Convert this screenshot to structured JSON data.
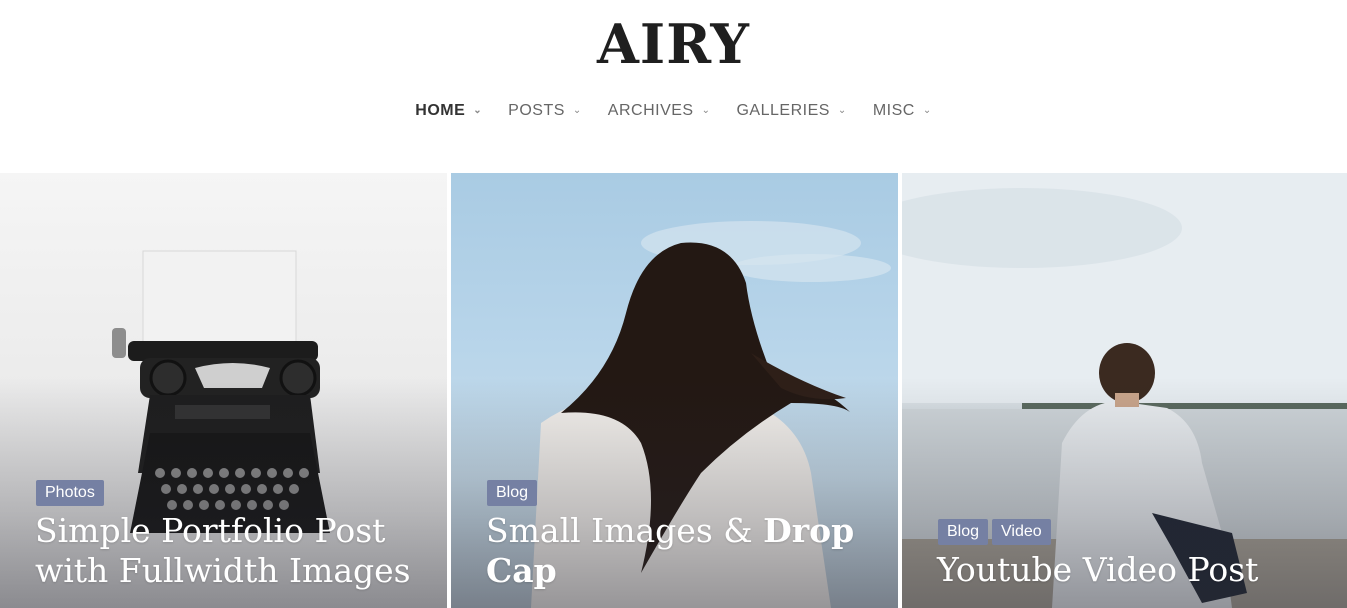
{
  "site": {
    "logo": "AIRY"
  },
  "nav": {
    "items": [
      {
        "label": "HOME",
        "active": true
      },
      {
        "label": "POSTS",
        "active": false
      },
      {
        "label": "ARCHIVES",
        "active": false
      },
      {
        "label": "GALLERIES",
        "active": false
      },
      {
        "label": "MISC",
        "active": false
      }
    ],
    "chevron_icon": "chevron-down-icon"
  },
  "posts": [
    {
      "tags": [
        "Photos"
      ],
      "title": "Simple Portfolio Post with Fullwidth Images",
      "image": "typewriter-photo"
    },
    {
      "tags": [
        "Blog"
      ],
      "title_regular": "Small Images & ",
      "title_bold": "Drop Cap",
      "image": "woman-long-hair-sky-photo"
    },
    {
      "tags": [
        "Blog",
        "Video"
      ],
      "title": "Youtube Video Post",
      "image": "man-sitting-by-lake-photo"
    }
  ],
  "colors": {
    "tag_bg": "#7580a3",
    "logo": "#1f1f1f",
    "nav_text": "#666666",
    "nav_active": "#333333"
  }
}
